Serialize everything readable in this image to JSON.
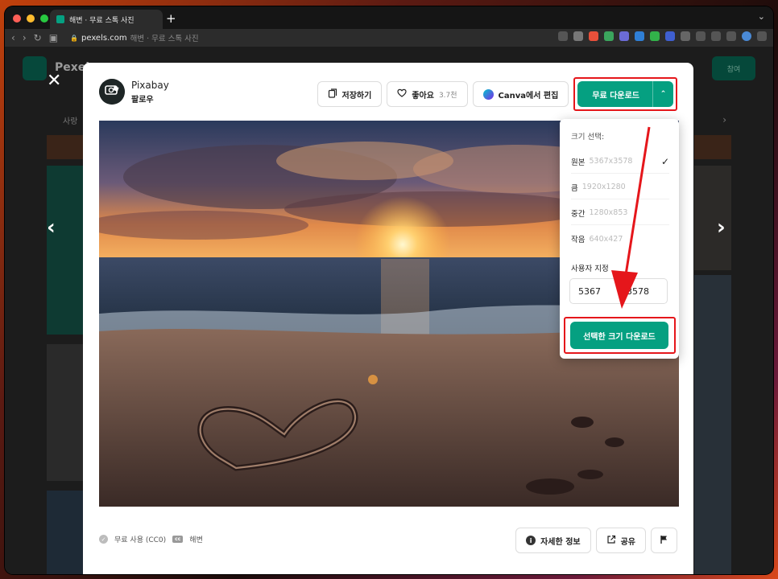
{
  "browser": {
    "tab_title": "해변 · 무료 스톡 사진",
    "new_tab": "+",
    "url_domain": "pexels.com",
    "url_rest": "해변 · 무료 스톡 사진"
  },
  "background": {
    "site_name": "Pexels",
    "tab_label": "사랑",
    "join_button": "참여"
  },
  "author": {
    "name": "Pixabay",
    "follow_label": "팔로우",
    "avatar_text": "pixabay"
  },
  "actions": {
    "save_label": "저장하기",
    "like_label": "좋아요",
    "like_count": "3.7천",
    "canva_label": "Canva에서 편집",
    "download_label": "무료 다운로드",
    "download_chevron": "^"
  },
  "size_menu": {
    "heading": "크기 선택:",
    "options": [
      {
        "name": "원본",
        "dims": "5367x3578",
        "selected": true
      },
      {
        "name": "큼",
        "dims": "1920x1280",
        "selected": false
      },
      {
        "name": "중간",
        "dims": "1280x853",
        "selected": false
      },
      {
        "name": "작음",
        "dims": "640x427",
        "selected": false
      }
    ],
    "custom_label": "사용자 지정",
    "custom_width": "5367",
    "custom_height": "3578",
    "download_selected_label": "선택한 크기 다운로드"
  },
  "footer": {
    "license_label": "무료 사용 (CC0)",
    "cc_badge": "cc",
    "tag_label": "해변",
    "details_label": "자세한 정보",
    "share_label": "공유"
  },
  "colors": {
    "accent": "#05a081",
    "highlight": "#e5161b"
  }
}
